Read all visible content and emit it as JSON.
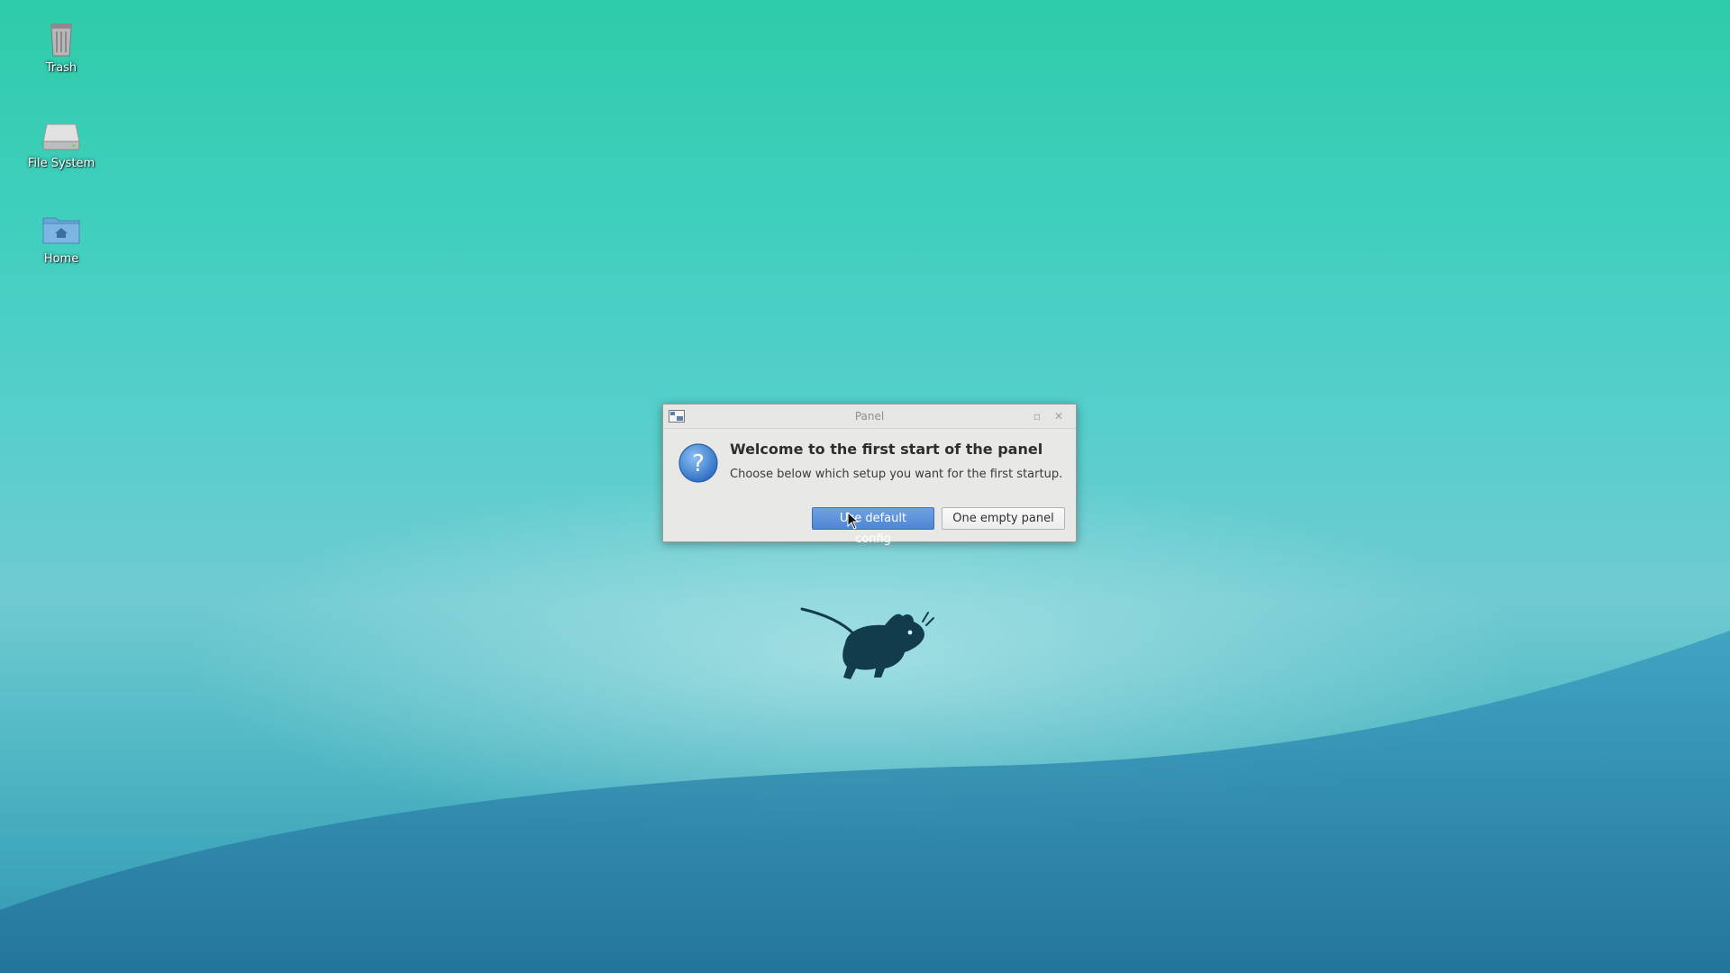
{
  "desktop": {
    "icons": [
      {
        "label": "Trash",
        "icon": "trash-icon"
      },
      {
        "label": "File System",
        "icon": "drive-icon"
      },
      {
        "label": "Home",
        "icon": "home-folder-icon"
      }
    ]
  },
  "dialog": {
    "title": "Panel",
    "heading": "Welcome to the first start of the panel",
    "message": "Choose below which setup you want for the first startup.",
    "buttons": {
      "default_config": "Use default config",
      "empty_panel": "One empty panel"
    },
    "icons": {
      "app": "panel-app-icon",
      "question": "question-icon",
      "maximize": "maximize-icon",
      "close": "close-icon"
    }
  },
  "colors": {
    "accent_button": "#4f86d4",
    "desktop_top": "#2ecba9",
    "desktop_bottom": "#2f95b3",
    "mascot": "#123c4c"
  }
}
